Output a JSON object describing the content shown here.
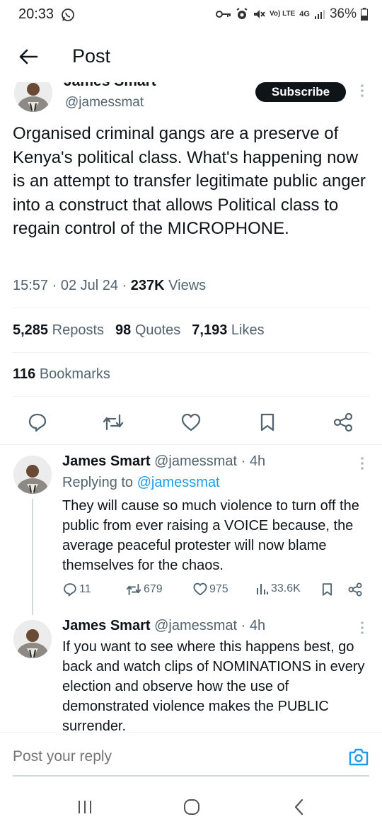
{
  "status_bar": {
    "time": "20:33",
    "volte_label": "Vo) LTE",
    "network_label": "4G",
    "battery": "36%"
  },
  "header": {
    "title": "Post"
  },
  "main_post": {
    "author_name": "James Smart",
    "author_handle": "@jamessmat",
    "subscribe_label": "Subscribe",
    "text": "Organised criminal gangs are a preserve of Kenya's political class. What's happening now is an attempt to transfer legitimate public anger into a construct that allows Political class to regain control of the MICROPHONE.",
    "timestamp": "15:57 · 02 Jul 24 · ",
    "views_count": "237K",
    "views_label": " Views",
    "reposts_count": "5,285",
    "reposts_label": "Reposts",
    "quotes_count": "98",
    "quotes_label": "Quotes",
    "likes_count": "7,193",
    "likes_label": "Likes",
    "bookmarks_count": "116",
    "bookmarks_label": "Bookmarks"
  },
  "replies": [
    {
      "name": "James Smart",
      "handle_time": "@jamessmat · 4h",
      "replying_prefix": "Replying to ",
      "replying_to": "@jamessmat",
      "text": "They will cause so much violence to turn off the public from ever raising a VOICE because, the average peaceful protester will now blame themselves for the chaos.",
      "replies": "11",
      "reposts": "679",
      "likes": "975",
      "views": "33.6K"
    },
    {
      "name": "James Smart",
      "handle_time": "@jamessmat · 4h",
      "text": "If you want to see where this happens best, go back and watch clips of NOMINATIONS in every election and observe how the use of demonstrated violence makes the PUBLIC surrender."
    }
  ],
  "composer": {
    "placeholder": "Post your reply"
  },
  "icons": {
    "back": "arrow-left-icon",
    "reply": "speech-bubble-icon",
    "repost": "repost-icon",
    "like": "heart-icon",
    "bookmark": "bookmark-icon",
    "share": "share-icon",
    "camera": "camera-icon"
  },
  "colors": {
    "accent": "#1d9bf0",
    "text": "#0f1419",
    "muted": "#536471"
  }
}
